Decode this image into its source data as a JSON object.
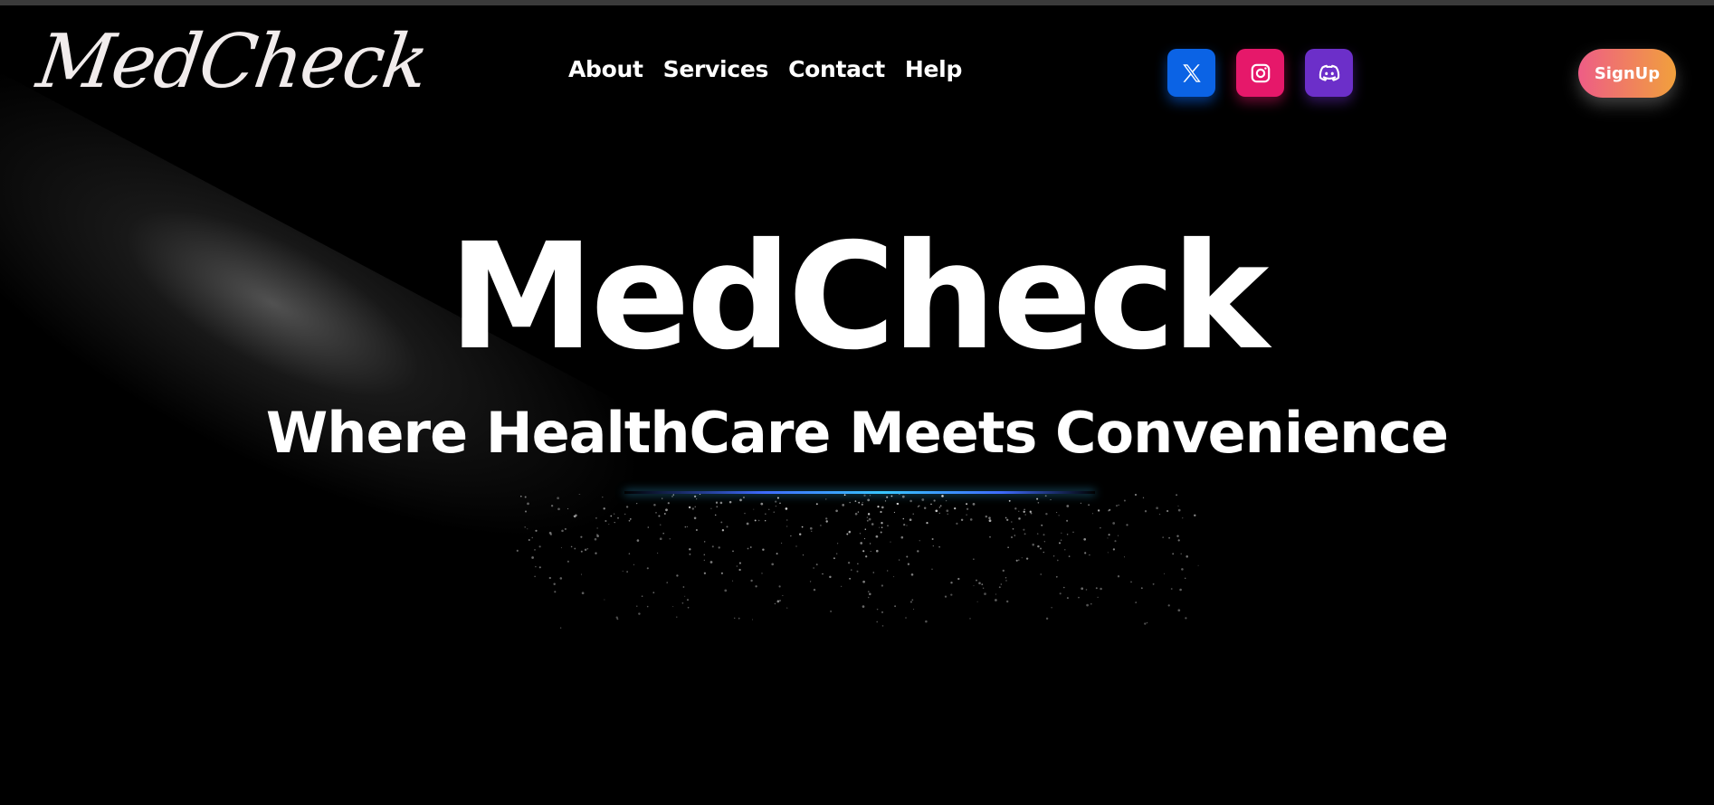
{
  "brand": {
    "logo_text": "MedCheck"
  },
  "nav": {
    "links": [
      {
        "label": "About"
      },
      {
        "label": "Services"
      },
      {
        "label": "Contact"
      },
      {
        "label": "Help"
      }
    ]
  },
  "socials": [
    {
      "icon": "x-twitter-icon",
      "color": "#0b63e5"
    },
    {
      "icon": "instagram-icon",
      "color": "#e6186a"
    },
    {
      "icon": "discord-icon",
      "color": "#6c2fc9"
    }
  ],
  "signup": {
    "label": "SignUp"
  },
  "hero": {
    "title": "MedCheck",
    "subtitle": "Where HealthCare Meets Convenience"
  },
  "colors": {
    "background": "#000000",
    "text": "#ffffff",
    "accent_line": "#39c6ff",
    "signup_gradient_start": "#ee5d86",
    "signup_gradient_end": "#f1a03c"
  }
}
